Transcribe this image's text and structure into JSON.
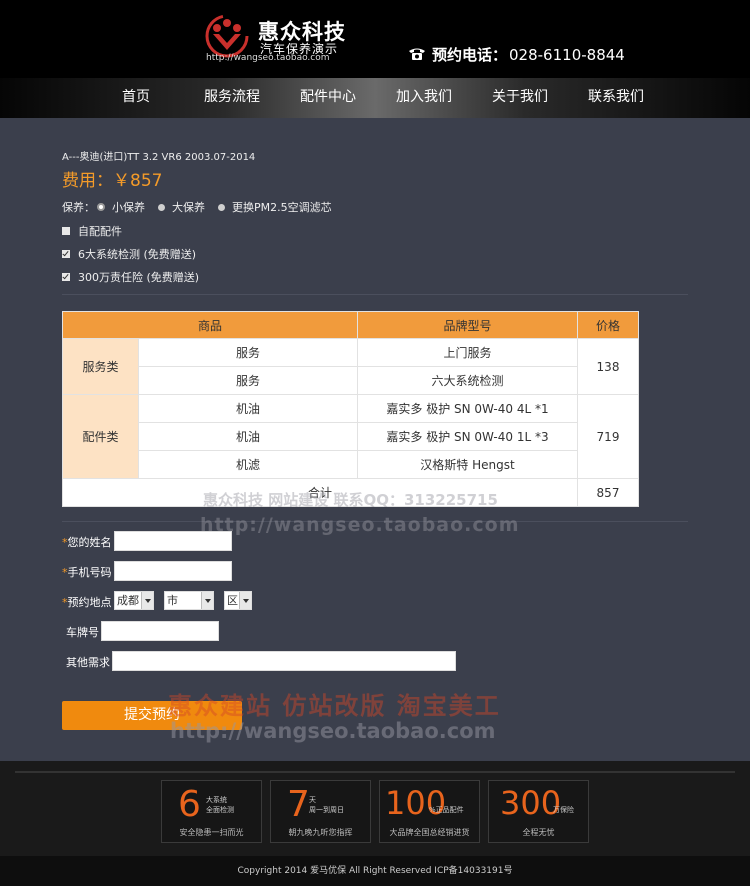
{
  "header": {
    "brand_name": "惠众科技",
    "brand_sub": "汽车保养演示",
    "brand_url": "http://wangseo.taobao.com",
    "phone_label": "预约电话：",
    "phone_number": "028-6110-8844"
  },
  "nav": {
    "items": [
      "首页",
      "服务流程",
      "配件中心",
      "加入我们",
      "关于我们",
      "联系我们"
    ]
  },
  "car": {
    "model": "A---奥迪(进口)TT 3.2 VR6 2003.07-2014",
    "fee": "费用：￥857"
  },
  "maintenance": {
    "label": "保养：",
    "options": [
      "小保养",
      "大保养",
      "更换PM2.5空调滤芯"
    ]
  },
  "checkboxes": [
    {
      "label": "自配配件",
      "checked": false
    },
    {
      "label": "6大系统检测 (免费赠送)",
      "checked": true
    },
    {
      "label": "300万责任险 (免费赠送)",
      "checked": true
    }
  ],
  "table": {
    "headers": [
      "商品",
      "品牌型号",
      "价格"
    ],
    "groups": [
      {
        "category": "服务类",
        "price": "138",
        "rows": [
          {
            "item": "服务",
            "brand": "上门服务"
          },
          {
            "item": "服务",
            "brand": "六大系统检测"
          }
        ]
      },
      {
        "category": "配件类",
        "price": "719",
        "rows": [
          {
            "item": "机油",
            "brand": "嘉实多 极护 SN 0W-40 4L *1"
          },
          {
            "item": "机油",
            "brand": "嘉实多 极护 SN 0W-40 1L *3"
          },
          {
            "item": "机滤",
            "brand": "汉格斯特 Hengst"
          }
        ]
      }
    ],
    "total_label": "合计",
    "total_price": "857"
  },
  "watermarks": {
    "line1": "惠众科技  网站建设  联系QQ：313225715",
    "line2": "http://wangseo.taobao.com",
    "line3": "惠众建站  仿站改版  淘宝美工",
    "line4": "http://wangseo.taobao.com"
  },
  "form": {
    "required_mark": "*",
    "name_label": "您的姓名",
    "phone_label": "手机号码",
    "location_label": "预约地点",
    "city_value": "成都",
    "district_value": "市",
    "area_value": "区",
    "plate_label": "车牌号",
    "other_label": "其他需求",
    "submit_label": "提交预约"
  },
  "features": [
    {
      "big": "6",
      "small1": "大系统",
      "small2": "全面检测",
      "caption": "安全隐患一扫而光"
    },
    {
      "big": "7",
      "small1": "天",
      "small2": "周一到周日",
      "caption": "朝九晚九听您指挥"
    },
    {
      "big": "100",
      "small1": "%正品配件",
      "small2": "",
      "caption": "大品牌全国总经销进货"
    },
    {
      "big": "300",
      "small1": "万保险",
      "small2": "",
      "caption": "全程无忧"
    }
  ],
  "footer": {
    "copyright": "Copyright 2014 爱马优保 All Right Reserved ICP备14033191号"
  },
  "colors": {
    "accent": "#f49b29",
    "button": "#f08a0e",
    "table_header": "#f19b3c",
    "category_bg": "#fde2c4",
    "body_bg": "#3b3f4c"
  }
}
